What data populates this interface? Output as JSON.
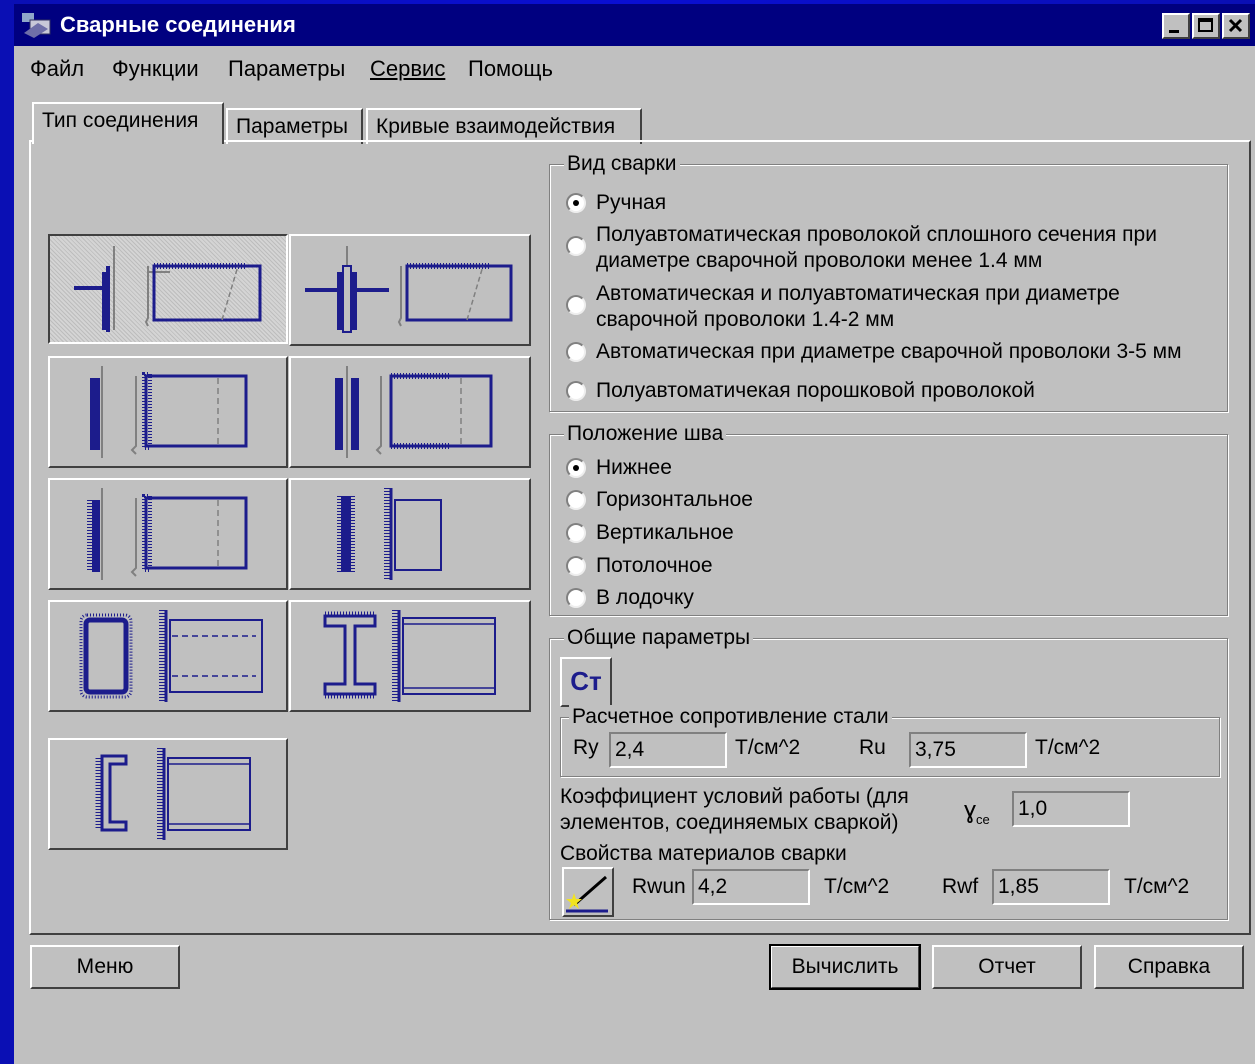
{
  "window": {
    "title": "Сварные соединения"
  },
  "menu": [
    "Файл",
    "Функции",
    "Параметры",
    "Сервис",
    "Помощь"
  ],
  "tabs": [
    "Тип соединения",
    "Параметры",
    "Кривые взаимодействия"
  ],
  "weld_type": {
    "label": "Вид сварки",
    "options": [
      "Ручная",
      "Полуавтоматическая проволокой сплошного сечения при диаметре сварочной проволоки менее 1.4 мм",
      "Автоматическая и полуавтоматическая при диаметре сварочной проволоки 1.4-2 мм",
      "Автоматическая при диаметре сварочной проволоки 3-5 мм",
      "Полуавтоматичекая порошковой проволокой"
    ],
    "selected": 0
  },
  "seam_position": {
    "label": "Положение шва",
    "options": [
      "Нижнее",
      "Горизонтальное",
      "Вертикальное",
      "Потолочное",
      "В лодочку"
    ],
    "selected": 0
  },
  "general": {
    "label": "Общие параметры",
    "steel_button": "Ст",
    "steel_resistance": {
      "label": "Расчетное сопротивление стали",
      "ry_label": "Ry",
      "ry_value": "2,4",
      "ru_label": "Ru",
      "ru_value": "3,75",
      "unit": "Т/см^2"
    },
    "coef_label_1": "Коэффициент условий работы (для",
    "coef_label_2": "элементов, соединяемых сваркой)",
    "coef_symbol": "ɣ",
    "coef_subscript": "ce",
    "coef_value": "1,0",
    "weld_materials": {
      "label": "Свойства материалов сварки",
      "rwun_label": "Rwun",
      "rwun_value": "4,2",
      "rwf_label": "Rwf",
      "rwf_value": "1,85",
      "unit": "Т/см^2"
    }
  },
  "buttons": {
    "menu": "Меню",
    "calculate": "Вычислить",
    "report": "Отчет",
    "help": "Справка"
  },
  "colors": {
    "title_bar": "#000080",
    "desktop": "#0a0fc8",
    "face": "#c0c0c0",
    "drawing": "#1c1c8c"
  }
}
